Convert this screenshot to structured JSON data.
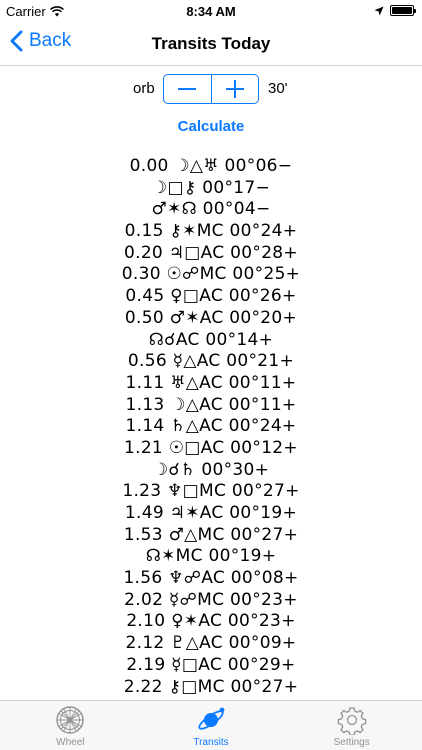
{
  "status_bar": {
    "carrier": "Carrier",
    "time": "8:34 AM"
  },
  "nav": {
    "back_label": "Back",
    "title": "Transits Today"
  },
  "orb": {
    "label": "orb",
    "value": "30'",
    "minus_label": "−",
    "plus_label": "+"
  },
  "calculate_label": "Calculate",
  "transits": [
    "0.00 ☽△♅ 00°06−",
    "☽□⚷ 00°17−",
    "♂✶☊ 00°04−",
    "0.15 ⚷✶MC 00°24+",
    "0.20 ♃□AC 00°28+",
    "0.30 ☉☍MC 00°25+",
    "0.45 ♀□AC 00°26+",
    "0.50 ♂✶AC 00°20+",
    "☊☌AC 00°14+",
    "0.56 ☿△AC 00°21+",
    "1.11 ♅△AC 00°11+",
    "1.13 ☽△AC 00°11+",
    "1.14 ♄△AC 00°24+",
    "1.21 ☉□AC 00°12+",
    "☽☌♄ 00°30+",
    "1.23 ♆□MC 00°27+",
    "1.49 ♃✶AC 00°19+",
    "1.53 ♂△MC 00°27+",
    "☊✶MC 00°19+",
    "1.56 ♆☍AC 00°08+",
    "2.02 ☿☍MC 00°23+",
    "2.10 ♀✶AC 00°23+",
    "2.12 ♇△AC 00°09+",
    "2.19 ☿□AC 00°29+",
    "2.22 ⚷□MC 00°27+"
  ],
  "tabs": [
    {
      "label": "Wheel",
      "icon": "wheel-icon",
      "active": false
    },
    {
      "label": "Transits",
      "icon": "transits-icon",
      "active": true
    },
    {
      "label": "Settings",
      "icon": "gear-icon",
      "active": false
    }
  ],
  "colors": {
    "accent": "#0a7aff",
    "inactive": "#929292"
  }
}
